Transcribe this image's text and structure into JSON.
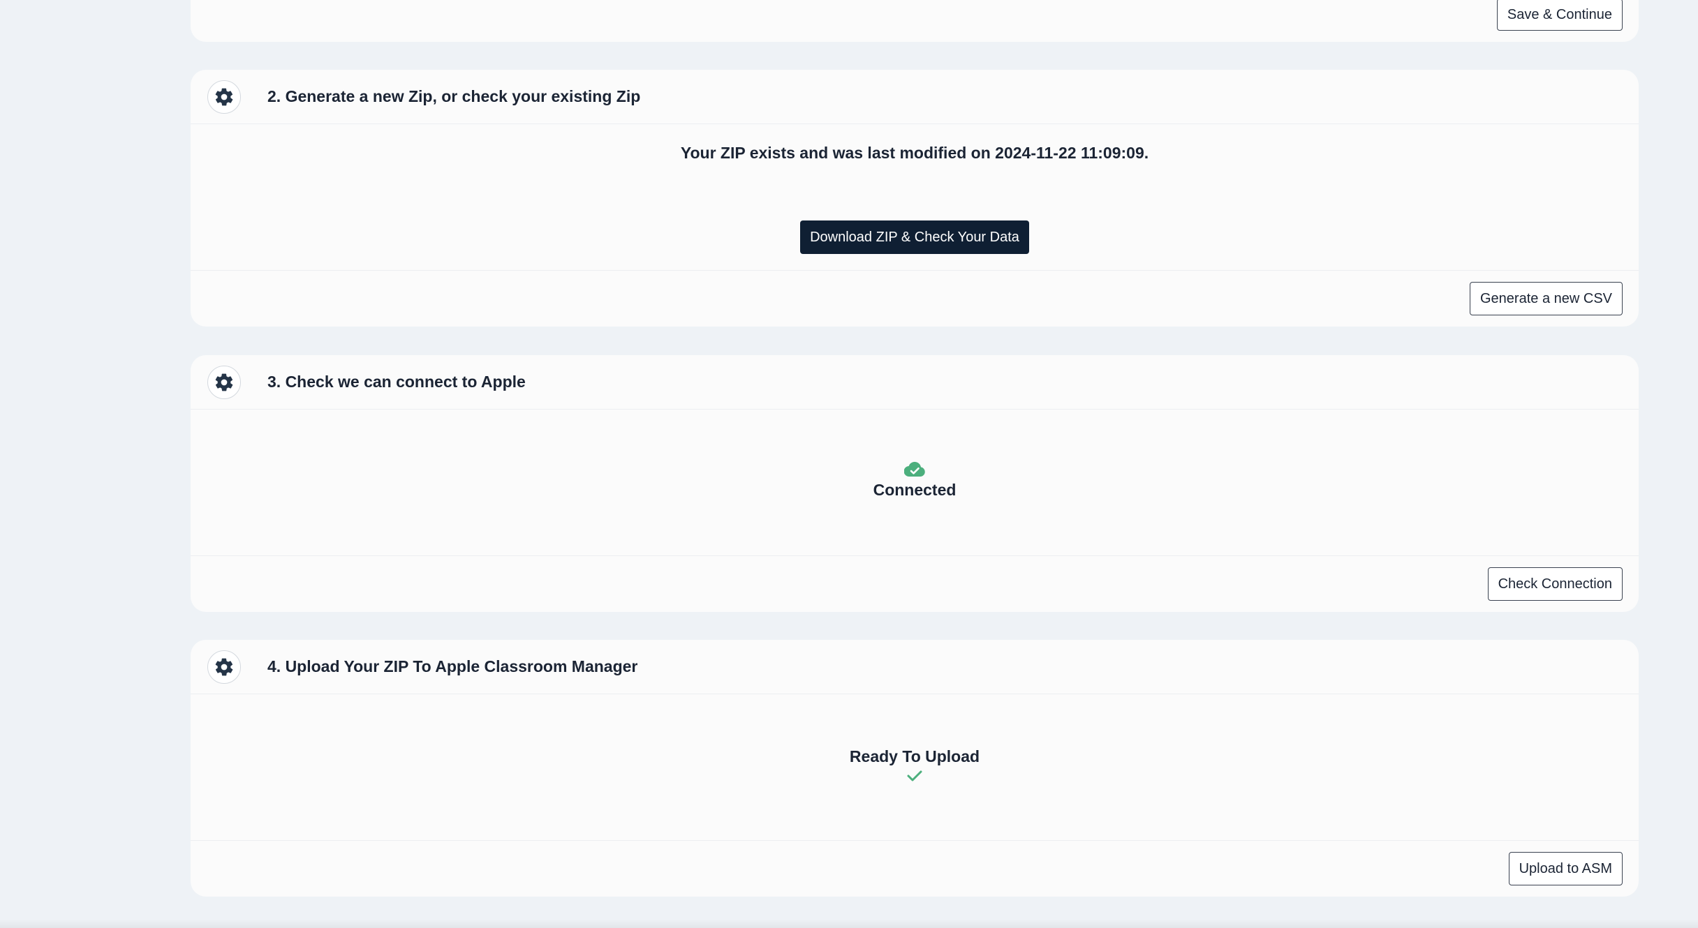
{
  "step1": {
    "save_label": "Save & Continue"
  },
  "step2": {
    "title": "2. Generate a new Zip, or check your existing Zip",
    "status_text": "Your ZIP exists and was last modified on 2024-11-22 11:09:09.",
    "download_label": "Download ZIP & Check Your Data",
    "generate_label": "Generate a new CSV"
  },
  "step3": {
    "title": "3. Check we can connect to Apple",
    "status_icon": "cloud-check-icon",
    "status_text": "Connected",
    "check_label": "Check Connection"
  },
  "step4": {
    "title": "4. Upload Your ZIP To Apple Classroom Manager",
    "status_text": "Ready To Upload",
    "status_icon": "check-icon",
    "upload_label": "Upload to ASM"
  },
  "colors": {
    "background": "#eef2f6",
    "card": "#fbfbfb",
    "primary_button": "#0f1f33",
    "success": "#4caf7d",
    "text": "#1b2434"
  }
}
